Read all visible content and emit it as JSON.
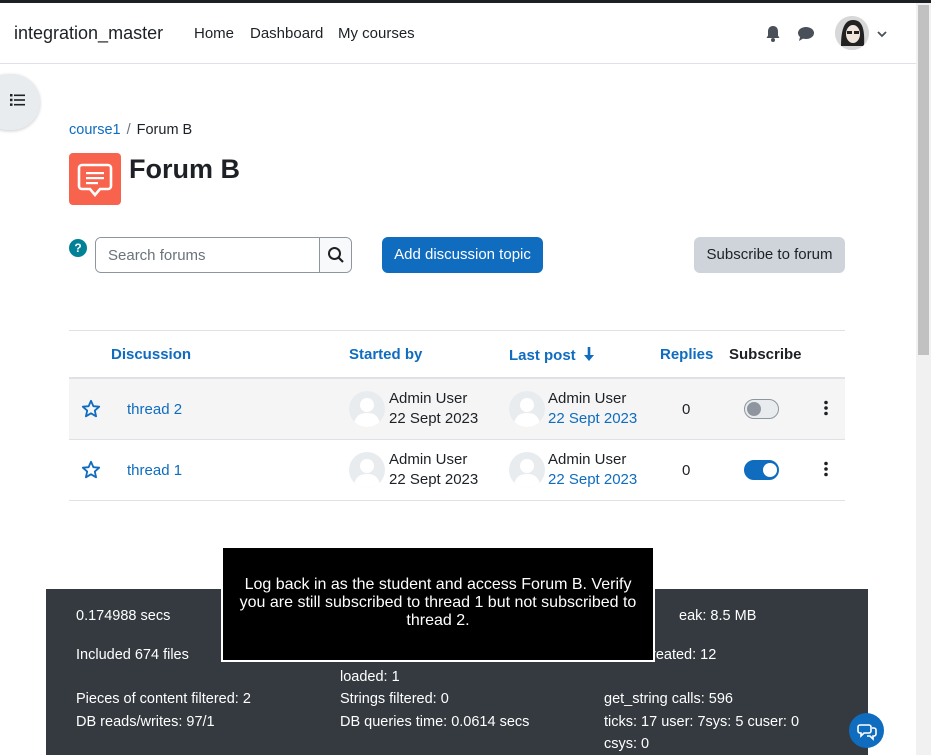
{
  "navbar": {
    "brand": "integration_master",
    "links": [
      "Home",
      "Dashboard",
      "My courses"
    ]
  },
  "breadcrumb": {
    "course": "course1",
    "separator": "/",
    "current": "Forum B"
  },
  "page": {
    "title": "Forum B"
  },
  "toolbar": {
    "help": "?",
    "search_placeholder": "Search forums",
    "add_label": "Add discussion topic",
    "subscribe_label": "Subscribe to forum"
  },
  "table": {
    "headers": {
      "discussion": "Discussion",
      "started_by": "Started by",
      "last_post": "Last post",
      "replies": "Replies",
      "subscribe": "Subscribe"
    },
    "rows": [
      {
        "title": "thread 2",
        "started_name": "Admin User",
        "started_date": "22 Sept 2023",
        "last_name": "Admin User",
        "last_date": "22 Sept 2023",
        "replies": "0",
        "subscribed": false
      },
      {
        "title": "thread 1",
        "started_name": "Admin User",
        "started_date": "22 Sept 2023",
        "last_name": "Admin User",
        "last_date": "22 Sept 2023",
        "replies": "0",
        "subscribed": true
      }
    ]
  },
  "footer": {
    "secs": "0.174988 secs",
    "files": "Included 674 files",
    "peak": "eak: 8.5 MB",
    "created": "reated: 12",
    "loaded": "loaded: 1",
    "filtered": "Pieces of content filtered: 2",
    "strings": "Strings filtered: 0",
    "getstring": "get_string calls: 596",
    "db": "DB reads/writes: 97/1",
    "dbtime": "DB queries time: 0.0614 secs",
    "ticks": "ticks: 17 user: 7sys: 5 cuser: 0",
    "csys": "csys: 0"
  },
  "overlay": {
    "text": "Log back in as the student and access Forum B. Verify you are still subscribed to thread 1 but not subscribed to thread 2."
  },
  "colors": {
    "primary": "#0f6cbf",
    "forum_icon": "#f7634d",
    "footer_bg": "#343a40"
  }
}
